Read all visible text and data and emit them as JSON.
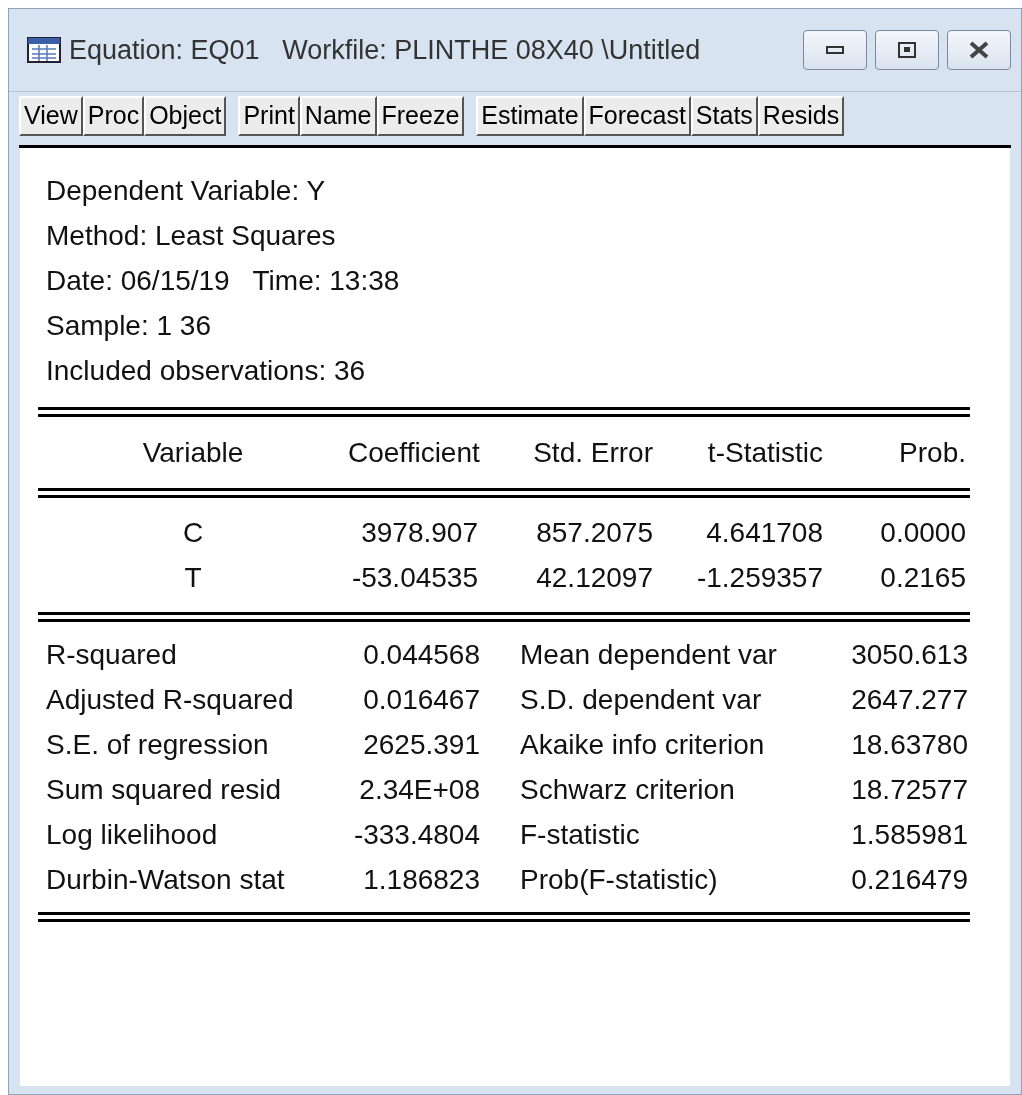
{
  "window": {
    "title": "Equation: EQ01   Workfile: PLINTHE 08X40 \\Untitled"
  },
  "toolbar": [
    [
      "View",
      "Proc",
      "Object"
    ],
    [
      "Print",
      "Name",
      "Freeze"
    ],
    [
      "Estimate",
      "Forecast",
      "Stats",
      "Resids"
    ]
  ],
  "header_lines": [
    "Dependent Variable: Y",
    "Method: Least Squares",
    "Date: 06/15/19   Time: 13:38",
    "Sample: 1 36",
    "Included observations: 36"
  ],
  "table": {
    "columns": [
      "Variable",
      "Coefficient",
      "Std. Error",
      "t-Statistic",
      "Prob."
    ],
    "rows": [
      [
        "C",
        "3978.907",
        "857.2075",
        "4.641708",
        "0.0000"
      ],
      [
        "T",
        "-53.04535",
        "42.12097",
        "-1.259357",
        "0.2165"
      ]
    ]
  },
  "statistics": [
    [
      "R-squared",
      "0.044568",
      "Mean dependent var",
      "3050.613"
    ],
    [
      "Adjusted R-squared",
      "0.016467",
      "S.D. dependent var",
      "2647.277"
    ],
    [
      "S.E. of regression",
      "2625.391",
      "Akaike info criterion",
      "18.63780"
    ],
    [
      "Sum squared resid",
      "2.34E+08",
      "Schwarz criterion",
      "18.72577"
    ],
    [
      "Log likelihood",
      "-333.4804",
      "F-statistic",
      "1.585981"
    ],
    [
      "Durbin-Watson stat",
      "1.186823",
      "Prob(F-statistic)",
      "0.216479"
    ]
  ]
}
